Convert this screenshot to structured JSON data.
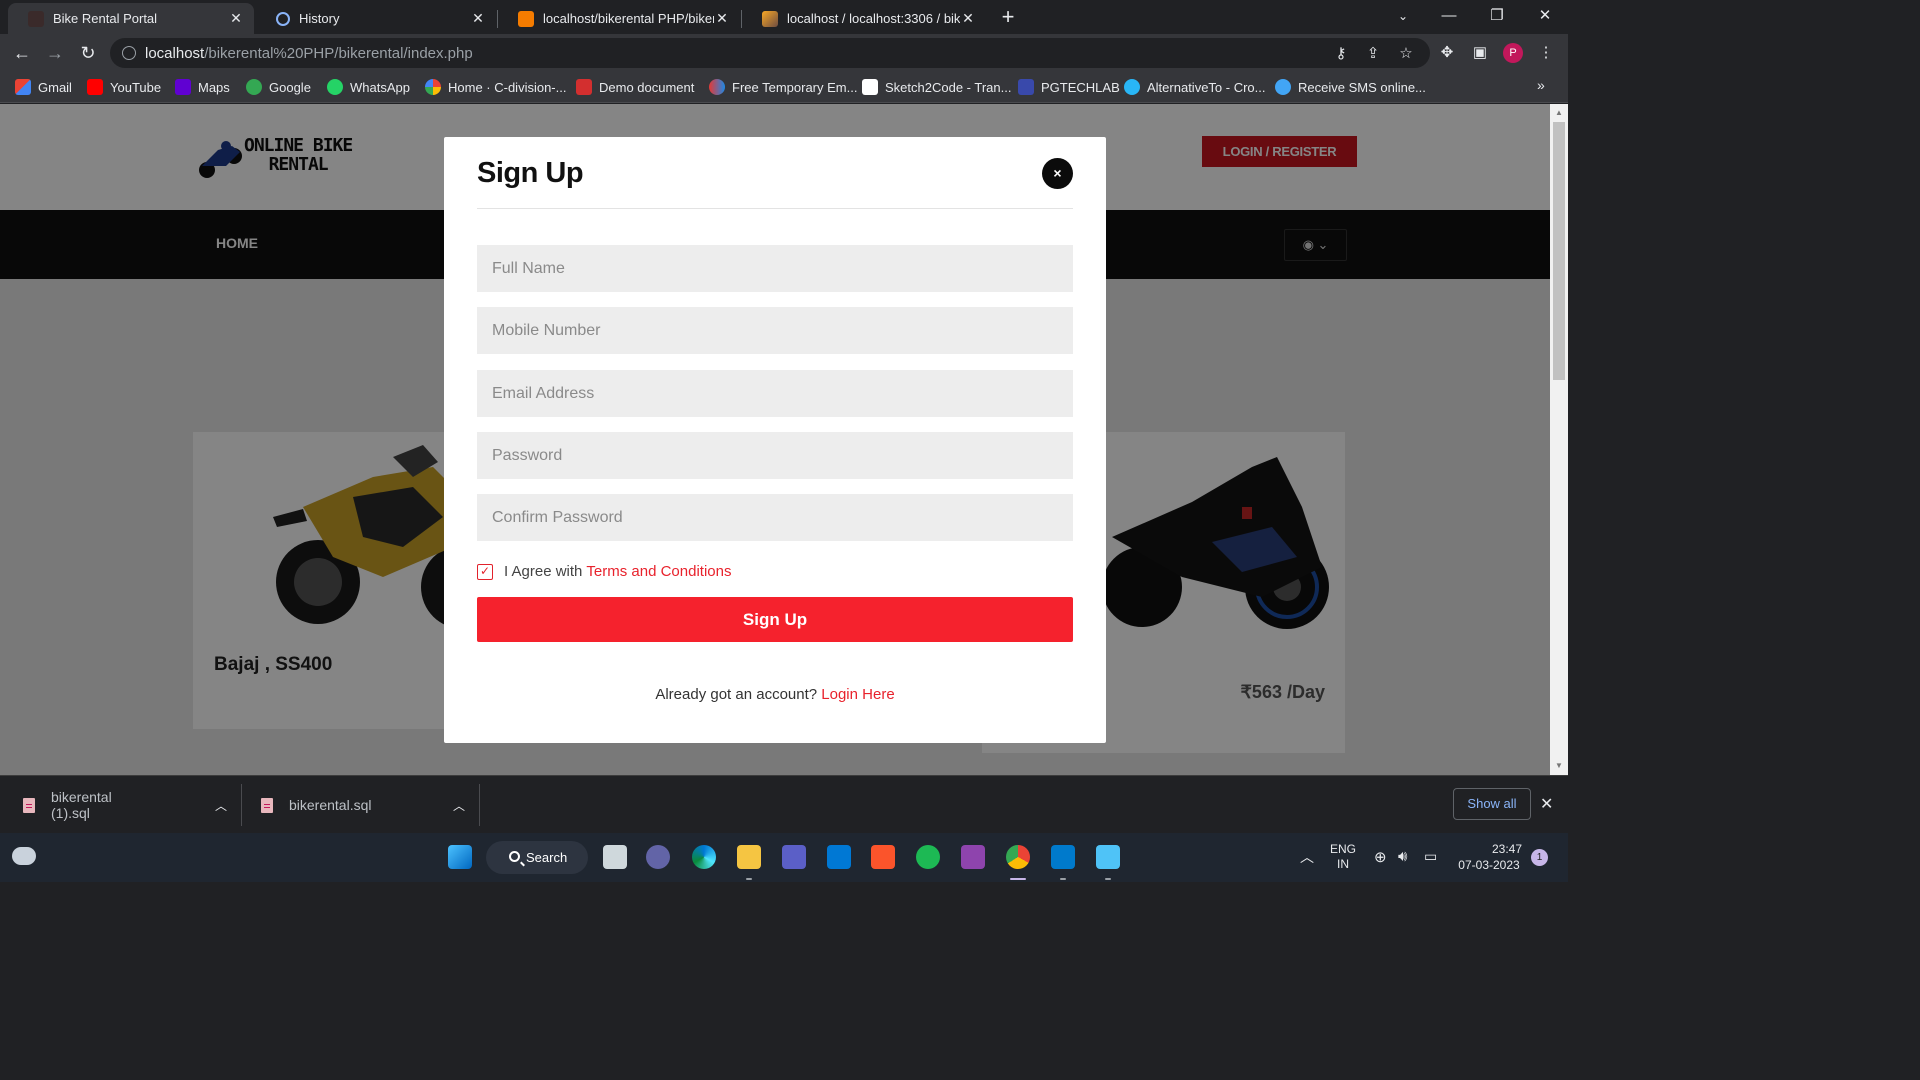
{
  "browser": {
    "tabs": [
      {
        "title": "Bike Rental Portal",
        "active": true
      },
      {
        "title": "History",
        "active": false
      },
      {
        "title": "localhost/bikerental PHP/bikeren",
        "active": false
      },
      {
        "title": "localhost / localhost:3306 / biken",
        "active": false
      }
    ],
    "url_host": "localhost",
    "url_path": "/bikerental%20PHP/bikerental/index.php",
    "profile_initial": "P"
  },
  "bookmarks": [
    "Gmail",
    "YouTube",
    "Maps",
    "Google",
    "WhatsApp",
    "Home · C-division-...",
    "Demo document",
    "Free Temporary Em...",
    "Sketch2Code - Tran...",
    "PGTECHLAB",
    "AlternativeTo - Cro...",
    "Receive SMS online..."
  ],
  "site": {
    "logo_line1": "ONLINE BIKE",
    "logo_line2": "RENTAL",
    "login_register": "LOGIN / REGISTER",
    "nav_home": "HOME",
    "cards": [
      {
        "name": "Bajaj , SS400",
        "price": ""
      },
      {
        "name": "",
        "price": "₹563 /Day"
      }
    ]
  },
  "modal": {
    "title": "Sign Up",
    "close": "×",
    "placeholders": {
      "full_name": "Full Name",
      "mobile": "Mobile Number",
      "email": "Email Address",
      "password": "Password",
      "confirm_password": "Confirm Password"
    },
    "agree_text": "I Agree with",
    "terms_link": "Terms and Conditions",
    "agree_checked": true,
    "submit": "Sign Up",
    "already_text": "Already got an account?",
    "login_link": "Login Here"
  },
  "downloads": {
    "items": [
      "bikerental (1).sql",
      "bikerental.sql"
    ],
    "show_all": "Show all"
  },
  "taskbar": {
    "search": "Search",
    "lang_line1": "ENG",
    "lang_line2": "IN",
    "time": "23:47",
    "date": "07-03-2023",
    "notifications": "1"
  },
  "colors": {
    "accent_red": "#f5222d",
    "login_button": "#c8161f",
    "nav_bar": "#111111"
  }
}
